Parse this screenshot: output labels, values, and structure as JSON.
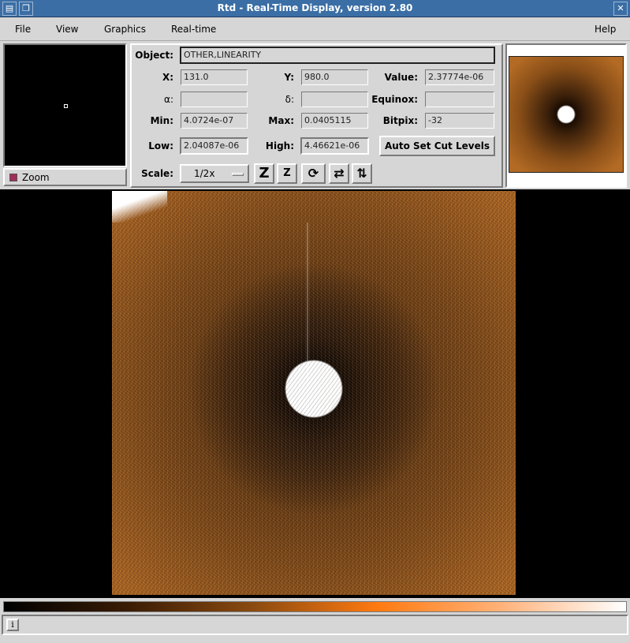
{
  "window": {
    "title": "Rtd - Real-Time Display, version 2.80",
    "close_glyph": "✕"
  },
  "menu": {
    "file": "File",
    "view": "View",
    "graphics": "Graphics",
    "realtime": "Real-time",
    "help": "Help"
  },
  "zoom": {
    "label": "Zoom"
  },
  "info": {
    "object_label": "Object:",
    "object_value": "OTHER,LINEARITY",
    "x_label": "X:",
    "x_value": "131.0",
    "y_label": "Y:",
    "y_value": "980.0",
    "value_label": "Value:",
    "value_value": "2.37774e-06",
    "alpha_label": "α:",
    "alpha_value": "",
    "delta_label": "δ:",
    "delta_value": "",
    "equinox_label": "Equinox:",
    "equinox_value": "",
    "min_label": "Min:",
    "min_value": "4.0724e-07",
    "max_label": "Max:",
    "max_value": "0.0405115",
    "bitpix_label": "Bitpix:",
    "bitpix_value": "-32",
    "low_label": "Low:",
    "low_value": "2.04087e-06",
    "high_label": "High:",
    "high_value": "4.46621e-06",
    "autoset_label": "Auto Set Cut Levels",
    "scale_label": "Scale:",
    "scale_value": "1/2x"
  },
  "toolbar": {
    "zoom_in": "Z",
    "zoom_out": "Z",
    "rotate": "⟳",
    "flip_x": "⇄",
    "flip_y": "⇅"
  },
  "status": {
    "icon": "i"
  },
  "colors": {
    "accent": "#3a6ea5",
    "background": "#d6d6d6",
    "image_tone": "#a45e1d"
  }
}
